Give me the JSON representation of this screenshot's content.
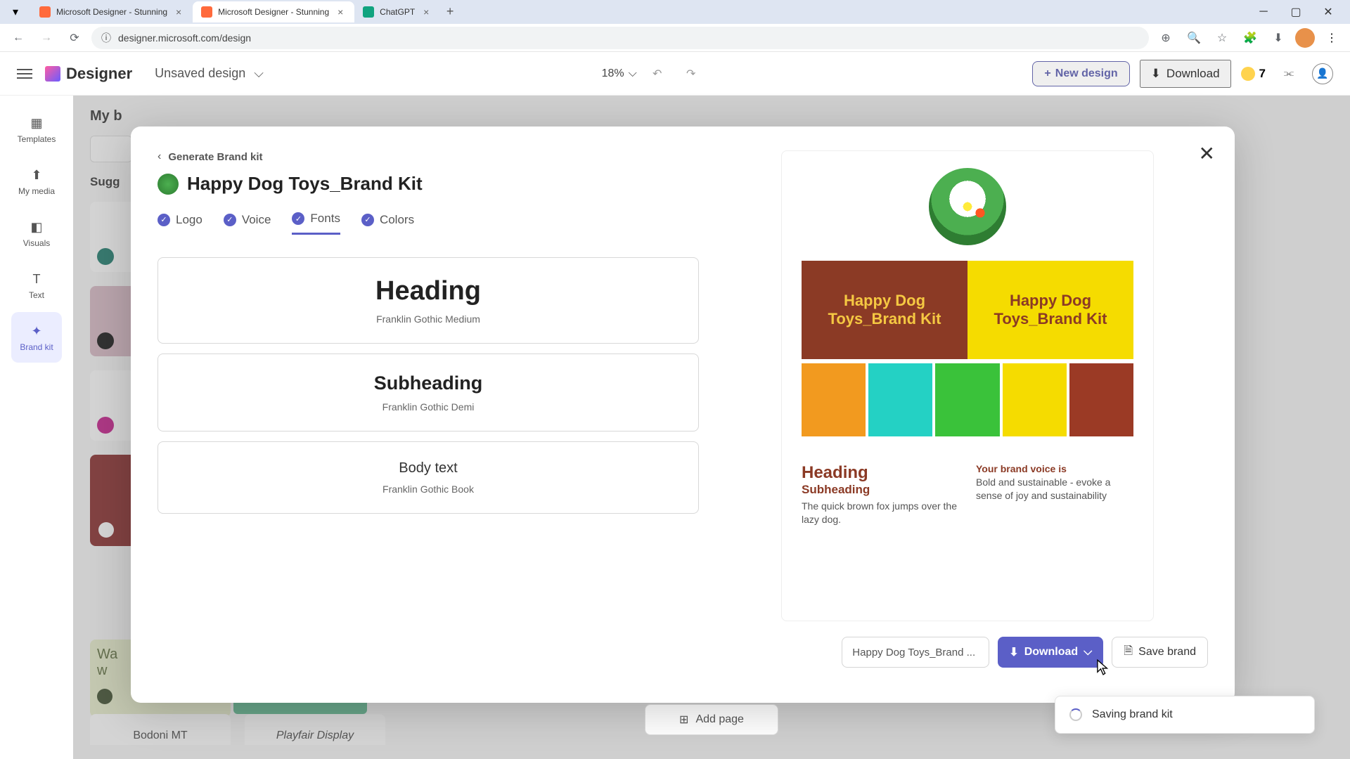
{
  "browser": {
    "tabs": [
      {
        "title": "Microsoft Designer - Stunning",
        "active": false
      },
      {
        "title": "Microsoft Designer - Stunning",
        "active": true
      },
      {
        "title": "ChatGPT",
        "active": false,
        "icon": "chatgpt"
      }
    ],
    "url": "designer.microsoft.com/design"
  },
  "app_header": {
    "brand": "Designer",
    "design_name": "Unsaved design",
    "zoom": "18%",
    "new_design_label": "New design",
    "download_label": "Download",
    "credits": "7"
  },
  "left_rail": [
    {
      "label": "Templates"
    },
    {
      "label": "My media"
    },
    {
      "label": "Visuals"
    },
    {
      "label": "Text"
    },
    {
      "label": "Brand kit",
      "active": true
    }
  ],
  "panel_behind": {
    "title": "My b",
    "section": "Sugg",
    "bottom_fonts": [
      "Bodoni MT",
      "Playfair Display"
    ],
    "wa_text": "Wa\n w"
  },
  "add_page_label": "Add page",
  "modal": {
    "breadcrumb": "Generate Brand kit",
    "kit_name": "Happy Dog Toys_Brand Kit",
    "tabs": [
      {
        "label": "Logo"
      },
      {
        "label": "Voice"
      },
      {
        "label": "Fonts",
        "active": true
      },
      {
        "label": "Colors"
      }
    ],
    "font_cards": [
      {
        "title": "Heading",
        "font": "Franklin Gothic Medium",
        "class": "fc-heading"
      },
      {
        "title": "Subheading",
        "font": "Franklin Gothic Demi",
        "class": "fc-subheading"
      },
      {
        "title": "Body text",
        "font": "Franklin Gothic Book",
        "class": "fc-body"
      }
    ],
    "preview": {
      "band_text": "Happy Dog Toys_Brand Kit",
      "swatches": [
        "#f29a1f",
        "#24d1c4",
        "#3ac23a",
        "#f5dc00",
        "#9b3a25"
      ],
      "heading": "Heading",
      "subheading": "Subheading",
      "body": "The quick brown fox jumps over the lazy dog.",
      "voice_label": "Your brand voice is",
      "voice_text": "Bold and sustainable - evoke a sense of joy and sustainability"
    },
    "actions": {
      "name_input": "Happy Dog Toys_Brand ...",
      "download": "Download",
      "save": "Save brand"
    }
  },
  "toast": "Saving brand kit"
}
